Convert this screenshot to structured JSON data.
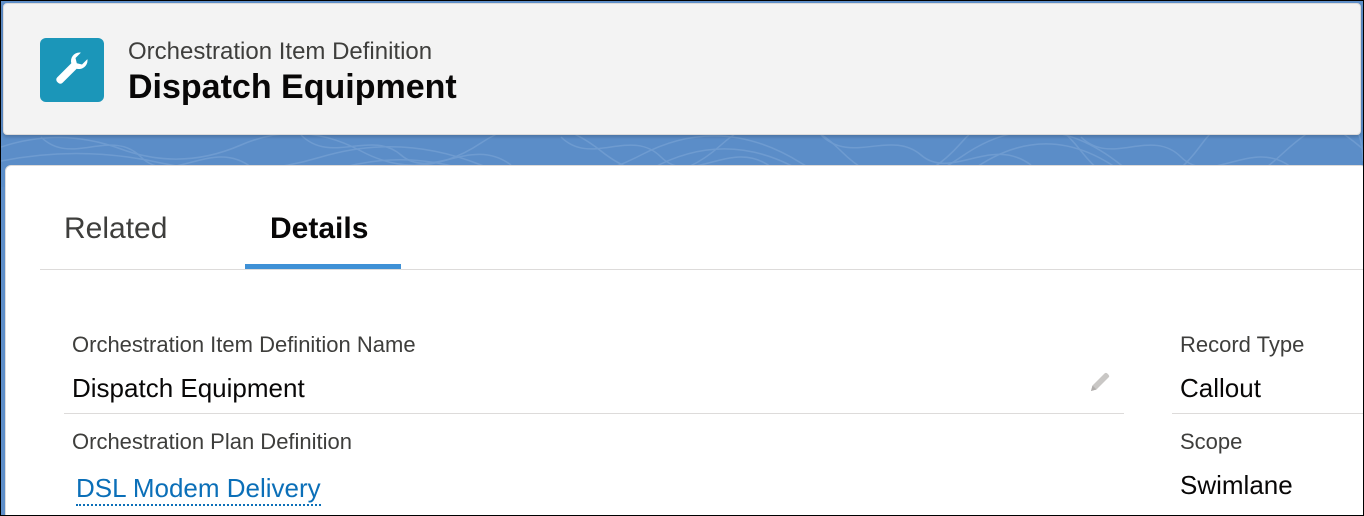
{
  "header": {
    "object_type": "Orchestration Item Definition",
    "record_title": "Dispatch Equipment",
    "icon": "wrench-icon",
    "icon_color": "#1b96b9"
  },
  "tabs": [
    {
      "label": "Related",
      "active": false
    },
    {
      "label": "Details",
      "active": true
    }
  ],
  "fields": {
    "name": {
      "label": "Orchestration Item Definition Name",
      "value": "Dispatch Equipment",
      "editable": true
    },
    "plan": {
      "label": "Orchestration Plan Definition",
      "value": "DSL Modem Delivery"
    },
    "record_type": {
      "label": "Record Type",
      "value": "Callout"
    },
    "scope": {
      "label": "Scope",
      "value": "Swimlane"
    }
  },
  "colors": {
    "brand_band": "#5b8dc8",
    "active_tab_underline": "#3f91d6",
    "link": "#0b6fb8"
  }
}
